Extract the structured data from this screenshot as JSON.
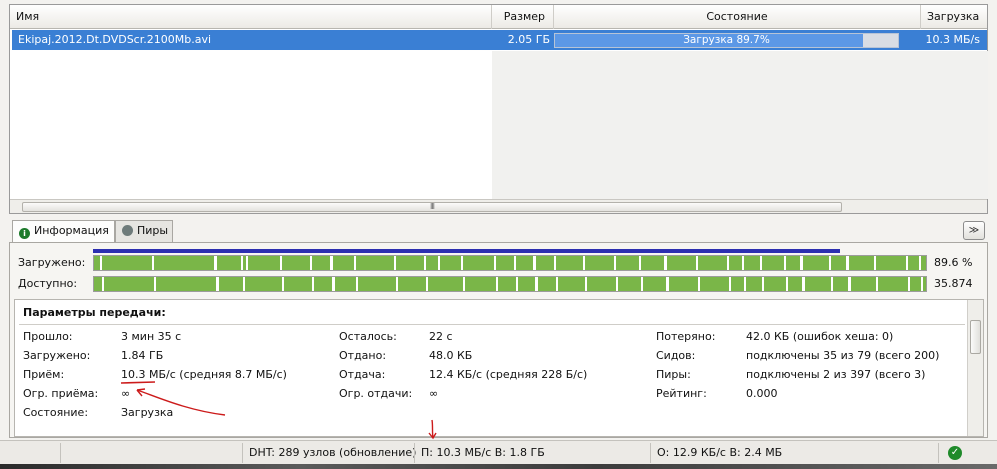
{
  "list": {
    "columns": {
      "name": "Имя",
      "size": "Размер",
      "state": "Состояние",
      "speed": "Загрузка"
    },
    "rows": [
      {
        "name": "Ekipaj.2012.Dt.DVDScr.2100Mb.avi",
        "size": "2.05 ГБ",
        "state": "Загрузка 89.7%",
        "progress": 0.897,
        "speed": "10.3 МБ/s"
      }
    ],
    "scroll_grip": "III"
  },
  "tabs": [
    {
      "label": "Информация",
      "icon": "info-icon"
    },
    {
      "label": "Пиры",
      "icon": "peers-icon"
    }
  ],
  "collapse_glyph": "≫",
  "pieces": {
    "downloaded_label": "Загружено:",
    "downloaded_value": "89.6 %",
    "downloaded_fraction": 0.896,
    "available_label": "Доступно:",
    "available_value": "35.874"
  },
  "params": {
    "title": "Параметры передачи:",
    "col1": [
      {
        "label": "Прошло:",
        "value": "3 мин 35 с"
      },
      {
        "label": "Загружено:",
        "value": "1.84 ГБ"
      },
      {
        "label": "Приём:",
        "value": "10.3 МБ/с (средняя 8.7 МБ/с)"
      },
      {
        "label": "Огр. приёма:",
        "value": "∞"
      },
      {
        "label": "Состояние:",
        "value": "Загрузка"
      }
    ],
    "col2": [
      {
        "label": "Осталось:",
        "value": "22 с"
      },
      {
        "label": "Отдано:",
        "value": "48.0 КБ"
      },
      {
        "label": "Отдача:",
        "value": "12.4 КБ/с (средняя 228 Б/с)"
      },
      {
        "label": "Огр. отдачи:",
        "value": "∞"
      }
    ],
    "col3": [
      {
        "label": "Потеряно:",
        "value": "42.0 КБ (ошибок хеша: 0)"
      },
      {
        "label": "Сидов:",
        "value": "подключены 35 из 79 (всего 200)"
      },
      {
        "label": "Пиры:",
        "value": "подключены 2 из 397 (всего 3)"
      },
      {
        "label": "Рейтинг:",
        "value": "0.000"
      }
    ]
  },
  "status": {
    "dht": "DHT: 289 узлов  (обновление)",
    "down": "П: 10.3 МБ/с В: 1.8 ГБ",
    "up": "О: 12.9 КБ/с В: 2.4 МБ",
    "ok_glyph": "✓"
  },
  "colors": {
    "selection": "#3a7fd4",
    "piece_green": "#7ab648",
    "annotation_red": "#cc1b1b"
  }
}
